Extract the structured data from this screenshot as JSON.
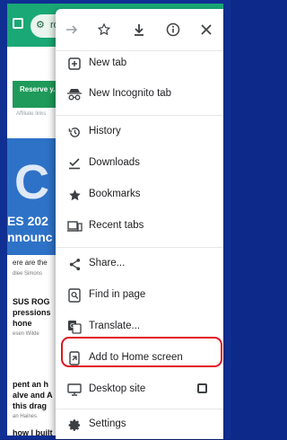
{
  "page": {
    "omnibox_text": "ro",
    "banner_text": "Reserve y... Samsung",
    "affiliate_text": "Affiliate links",
    "hero_big": "C",
    "hero_line1": "ES 202",
    "hero_line2": "nnounc",
    "para1": "ere are the",
    "byline1": "dlee Simons",
    "headline1_a": "SUS ROG",
    "headline1_b": "pressions",
    "headline1_c": "hone",
    "byline2": "esen Wilde",
    "headline2_a": "pent an h",
    "headline2_b": "alve and A",
    "headline2_c": "this drag",
    "byline3": "an Haines",
    "footer_text": "how I built"
  },
  "menu": {
    "actions": [
      {
        "name": "forward",
        "icon": "arrow-forward-icon"
      },
      {
        "name": "bookmark",
        "icon": "star-outline-icon"
      },
      {
        "name": "download",
        "icon": "download-icon"
      },
      {
        "name": "page-info",
        "icon": "info-icon"
      },
      {
        "name": "close",
        "icon": "close-icon"
      }
    ],
    "items": [
      {
        "label": "New tab",
        "icon": "plus-box-icon"
      },
      {
        "label": "New Incognito tab",
        "icon": "incognito-icon"
      },
      {
        "label": "History",
        "icon": "history-icon"
      },
      {
        "label": "Downloads",
        "icon": "download-done-icon"
      },
      {
        "label": "Bookmarks",
        "icon": "star-filled-icon"
      },
      {
        "label": "Recent tabs",
        "icon": "devices-icon"
      },
      {
        "label": "Share...",
        "icon": "share-icon"
      },
      {
        "label": "Find in page",
        "icon": "find-in-page-icon"
      },
      {
        "label": "Translate...",
        "icon": "translate-icon"
      },
      {
        "label": "Add to Home screen",
        "icon": "add-to-home-icon",
        "highlighted": true
      },
      {
        "label": "Desktop site",
        "icon": "desktop-icon",
        "checkbox": false
      },
      {
        "label": "Settings",
        "icon": "gear-icon"
      }
    ],
    "highlight_color": "#e0141e"
  }
}
